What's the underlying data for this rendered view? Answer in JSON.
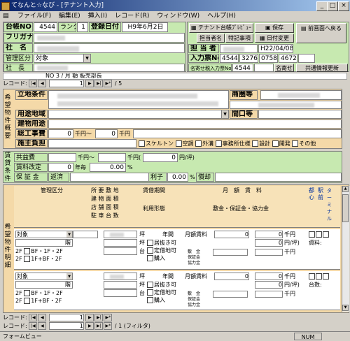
{
  "window": {
    "title": "てなんと☆なび - [テナント入力]",
    "minimize": "_",
    "maximize": "□",
    "close": "×"
  },
  "menu": [
    "ファイル(F)",
    "編集(E)",
    "挿入(I)",
    "レコード(R)",
    "ウィンドウ(W)",
    "ヘルプ(H)"
  ],
  "header": {
    "daicho_label": "台帳NO",
    "daicho_value": "4544",
    "rank_label": "ランク",
    "rank_value": "1",
    "toroku_label": "登録日付",
    "toroku_value": "H9年6月2日",
    "furigana_label": "フリガナ",
    "shamei_label": "社　名",
    "kanri_label": "管理区分",
    "kanri_value": "対象",
    "shacho_label": "社　長",
    "record_label": "レコード:",
    "record_value": "1",
    "record_total": "/ 5",
    "preview_button": "テナント台帳ﾌﾟﾚﾋﾞｭｰ",
    "save_button": "保存",
    "back_button": "前画面へ戻る",
    "tanto_label": "担当者名",
    "tokki_label": "特記事項",
    "date_change_button": "日付変更",
    "tanto_field_label": "担 当 者",
    "tanto_date": "H22/04/08",
    "nyuryoku_label": "入力票No",
    "nyuryoku_values": [
      "4544",
      "3276",
      "0758",
      "4672"
    ],
    "meiyose_label": "名寄せ親入力票No",
    "meiyose_value": "4544",
    "meiyose_button": "名寄せ",
    "kyotsu_button": "共通情報更新"
  },
  "side_labels": {
    "kibo": "希望物件概要",
    "chintai": "賃貸条件",
    "kibo2": "希望物件明細"
  },
  "overview": {
    "partial_row": "NO  3 / 月 額  販売部長",
    "ritchi_label": "立地条件",
    "shogo_label": "商圏等",
    "yoto_label": "用途地域",
    "maguchi_label": "間口等",
    "tatemono_label": "建物用途",
    "sokoji_label": "総工事費",
    "sokoji_v1": "0",
    "sokoji_u1": "千円～",
    "sokoji_v2": "0",
    "sokoji_u2": "千円",
    "seko_label": "施主負担",
    "checks": [
      "スケルトン",
      "空調",
      "外溝",
      "事務所仕様",
      "設計",
      "開発",
      "その他"
    ]
  },
  "rent": {
    "kyoeki_label": "共益費",
    "kyoeki_u1": "千円～",
    "kyoeki_u2": "千円(",
    "kyoeki_v": "0",
    "kyoeki_u3": "円/坪)",
    "kaitei_label": "賃料改定",
    "kaitei_v": "0",
    "kaitei_u": "年毎",
    "kaitei_pct_v": "0.00",
    "kaitei_pct_u": "%",
    "hosho_label": "保 証 金",
    "henkan_label": "返済",
    "rishi_label": "利子",
    "rishi_v": "0.00",
    "rishi_u": "%",
    "shokyaku_label": "償却"
  },
  "grid": {
    "headers": {
      "kanri": "管理区分",
      "shoyo": "所 要 敷 地",
      "tatemono": "建 物 面 積",
      "tenpo": "店 舗 面 積",
      "chusha": "駐 車 台 数",
      "chintaikikan": "賃借期間",
      "riyo": "利用形態",
      "getsugaku": "月　額　賃　料",
      "kingaku": "敷金・保証金・協力金",
      "toko": "都心",
      "eki": "駅前",
      "terminal": "ターミナル"
    },
    "rows": [
      {
        "kanri": "対象",
        "floor1": "階",
        "floor_opts": [
          "BF・1F・2F",
          "1F+BF・2F"
        ],
        "tsubo": [
          "坪",
          "坪",
          "台"
        ],
        "nenkan": "年間",
        "checks": [
          "居抜き可",
          "定借地可",
          "購入"
        ],
        "chinryo_label": "月額賃料",
        "chinryo_v": "0",
        "chinryo_u": "千円",
        "yen_u": "円/坪)",
        "shiki": "敷　金",
        "hosho": "保証金",
        "kyoryoku": "協力金",
        "sen": "千円",
        "tail": "資料:"
      },
      {
        "kanri": "対象",
        "floor1": "階",
        "floor_opts": [
          "BF・1F・2F",
          "1F+BF・2F"
        ],
        "tsubo": [
          "坪",
          "坪",
          "台"
        ],
        "nenkan": "年間",
        "checks": [
          "居抜き可",
          "定借地可",
          "購入"
        ],
        "chinryo_label": "月額賃料",
        "chinryo_v": "0",
        "chinryo_u": "千円",
        "yen_u": "円/坪)",
        "shiki": "敷　金",
        "hosho": "保証金",
        "kyoryoku": "協力金",
        "sen": "千円",
        "tail": "台数:"
      }
    ]
  },
  "bottom_record": {
    "label": "レコード:",
    "value": "1",
    "total": "/ 1 (フィルタ)"
  },
  "status": {
    "left": "フォームビュー",
    "num": "NUM"
  }
}
